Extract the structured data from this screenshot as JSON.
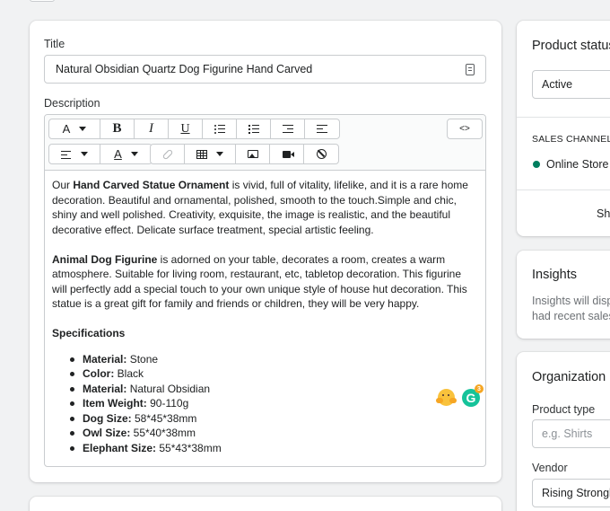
{
  "product": {
    "title_label": "Title",
    "title_value": "Natural Obsidian Quartz Dog Figurine Hand Carved",
    "description_label": "Description",
    "description": {
      "p1_a": "Our ",
      "p1_b": "Hand Carved Statue Ornament",
      "p1_c": " is vivid, full of vitality, lifelike, and it is a rare home decoration. Beautiful and ornamental, polished, smooth to the touch.Simple and chic, shiny and well polished. Creativity, exquisite, the image is realistic, and the beautiful decorative effect. Delicate surface treatment, special artistic feeling.",
      "p2_a": "Animal Dog Figurine",
      "p2_b": " is adorned on your table, decorates a room, creates a warm atmosphere. Suitable for living room, restaurant, etc, tabletop decoration. This figurine will perfectly add a special touch to your own unique style of house hut decoration. This statue is a great gift for family and friends or children, they will be very happy.",
      "spec_heading": "Specifications",
      "specs": [
        {
          "key": "Material:",
          "value": " Stone"
        },
        {
          "key": "Color:",
          "value": " Black"
        },
        {
          "key": "Material:",
          "value": " Natural Obsidian"
        },
        {
          "key": "Item Weight:",
          "value": " 90-110g"
        },
        {
          "key": "Dog Size:",
          "value": " 58*45*38mm"
        },
        {
          "key": "Owl Size:",
          "value": " 55*40*38mm"
        },
        {
          "key": "Elephant Size:",
          "value": " 55*43*38mm"
        }
      ]
    },
    "toolbar": {
      "font": "A",
      "bold": "B",
      "italic": "I",
      "underline": "U",
      "code": "<>",
      "color": "A"
    },
    "grammarly": {
      "letter": "G",
      "count": "3"
    }
  },
  "sidebar": {
    "status": {
      "title": "Product status",
      "value": "Active",
      "sales_channels_label": "SALES CHANNELS",
      "channel": "Online Store a",
      "link": "Sh"
    },
    "insights": {
      "title": "Insights",
      "line1": "Insights will disp",
      "line2": "had recent sales"
    },
    "organization": {
      "title": "Organization",
      "product_type_label": "Product type",
      "product_type_placeholder": "e.g. Shirts",
      "vendor_label": "Vendor",
      "vendor_value": "Rising Strongly"
    }
  },
  "colors": {
    "accent": "#007f5f",
    "background": "#f1f2f3"
  }
}
